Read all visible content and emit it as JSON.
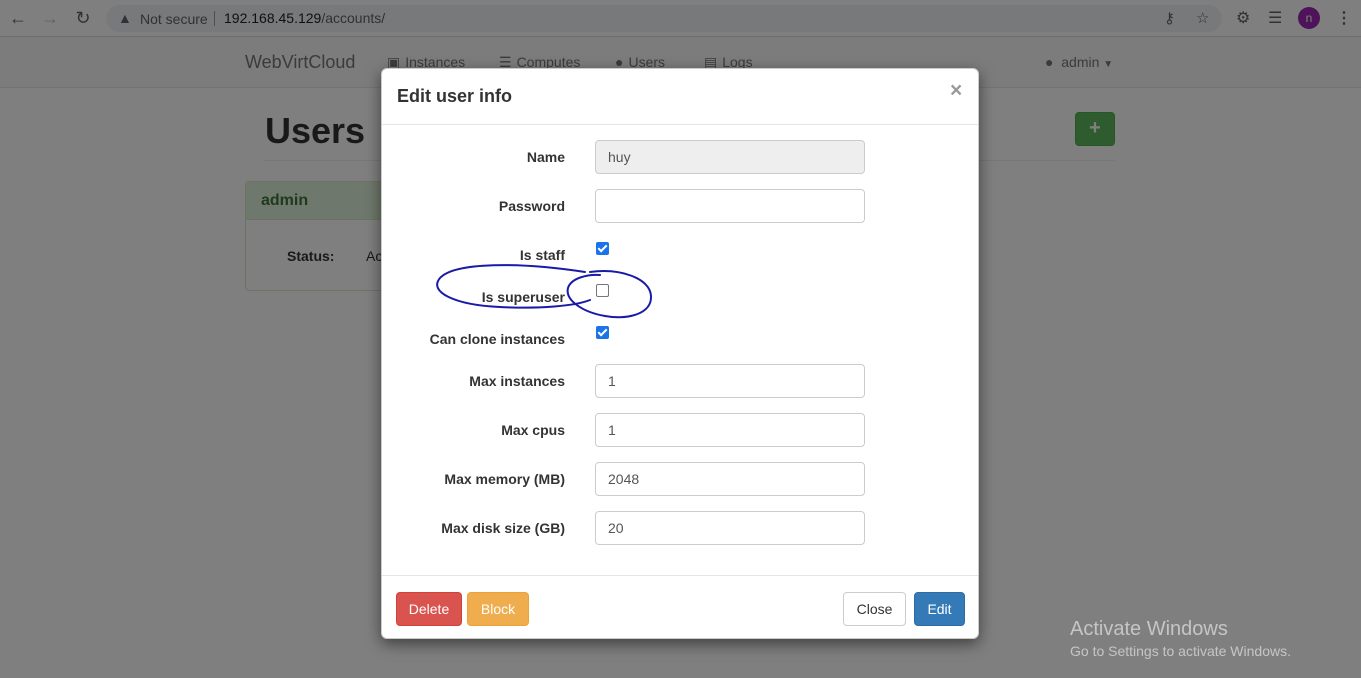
{
  "browser": {
    "security_label": "Not secure",
    "url_host": "192.168.45.129",
    "url_path": "/accounts/",
    "profile_initial": "n"
  },
  "navbar": {
    "brand": "WebVirtCloud",
    "links": [
      {
        "label": "Instances",
        "icon": "desktop-icon"
      },
      {
        "label": "Computes",
        "icon": "server-icon"
      },
      {
        "label": "Users",
        "icon": "users-icon"
      },
      {
        "label": "Logs",
        "icon": "list-icon"
      }
    ],
    "user_menu": "admin"
  },
  "page": {
    "title": "Users",
    "add_button": "+",
    "panel": {
      "heading": "admin",
      "status_label": "Status:",
      "status_value_partial": "Ac"
    }
  },
  "modal": {
    "title": "Edit user info",
    "close_glyph": "×",
    "fields": {
      "name": {
        "label": "Name",
        "value": "huy"
      },
      "password": {
        "label": "Password",
        "value": ""
      },
      "is_staff": {
        "label": "Is staff",
        "checked": true
      },
      "is_superuser": {
        "label": "Is superuser",
        "checked": false
      },
      "can_clone": {
        "label": "Can clone instances",
        "checked": true
      },
      "max_instances": {
        "label": "Max instances",
        "value": "1"
      },
      "max_cpus": {
        "label": "Max cpus",
        "value": "1"
      },
      "max_memory": {
        "label": "Max memory (MB)",
        "value": "2048"
      },
      "max_disk": {
        "label": "Max disk size (GB)",
        "value": "20"
      }
    },
    "buttons": {
      "delete": "Delete",
      "block": "Block",
      "close": "Close",
      "edit": "Edit"
    }
  },
  "watermark": {
    "line1": "Activate Windows",
    "line2": "Go to Settings to activate Windows."
  },
  "colors": {
    "annotation_ink": "#1a1aa8",
    "primary": "#337ab7",
    "danger": "#d9534f",
    "warning": "#f0ad4e",
    "success": "#5cb85c"
  }
}
